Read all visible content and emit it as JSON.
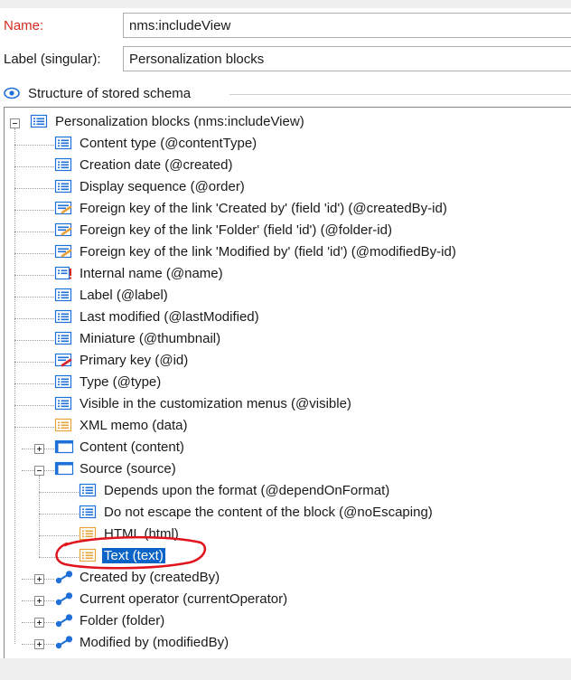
{
  "form": {
    "name_label": "Name:",
    "name_value": "nms:includeView",
    "label_label": "Label (singular):",
    "label_value": "Personalization blocks"
  },
  "section": {
    "title": "Structure of stored schema"
  },
  "tree": {
    "root": "Personalization blocks (nms:includeView)",
    "attributes": [
      "Content type (@contentType)",
      "Creation date (@created)",
      "Display sequence (@order)",
      "Foreign key of the link 'Created by' (field 'id') (@createdBy-id)",
      "Foreign key of the link 'Folder' (field 'id') (@folder-id)",
      "Foreign key of the link 'Modified by' (field 'id') (@modifiedBy-id)",
      "Internal name (@name)",
      "Label (@label)",
      "Last modified (@lastModified)",
      "Miniature (@thumbnail)",
      "Primary key (@id)",
      "Type (@type)",
      "Visible in the customization menus (@visible)",
      "XML memo (data)"
    ],
    "content_node": "Content (content)",
    "source_node": "Source (source)",
    "source_children": [
      "Depends upon the format (@dependOnFormat)",
      "Do not escape the content of the block (@noEscaping)",
      "HTML (html)",
      "Text (text)"
    ],
    "links": [
      "Created by (createdBy)",
      "Current operator (currentOperator)",
      "Folder (folder)",
      "Modified by (modifiedBy)"
    ]
  },
  "colors": {
    "required_label": "#d52b1e",
    "selection": "#0a64c8",
    "annotation": "#e0141e"
  }
}
